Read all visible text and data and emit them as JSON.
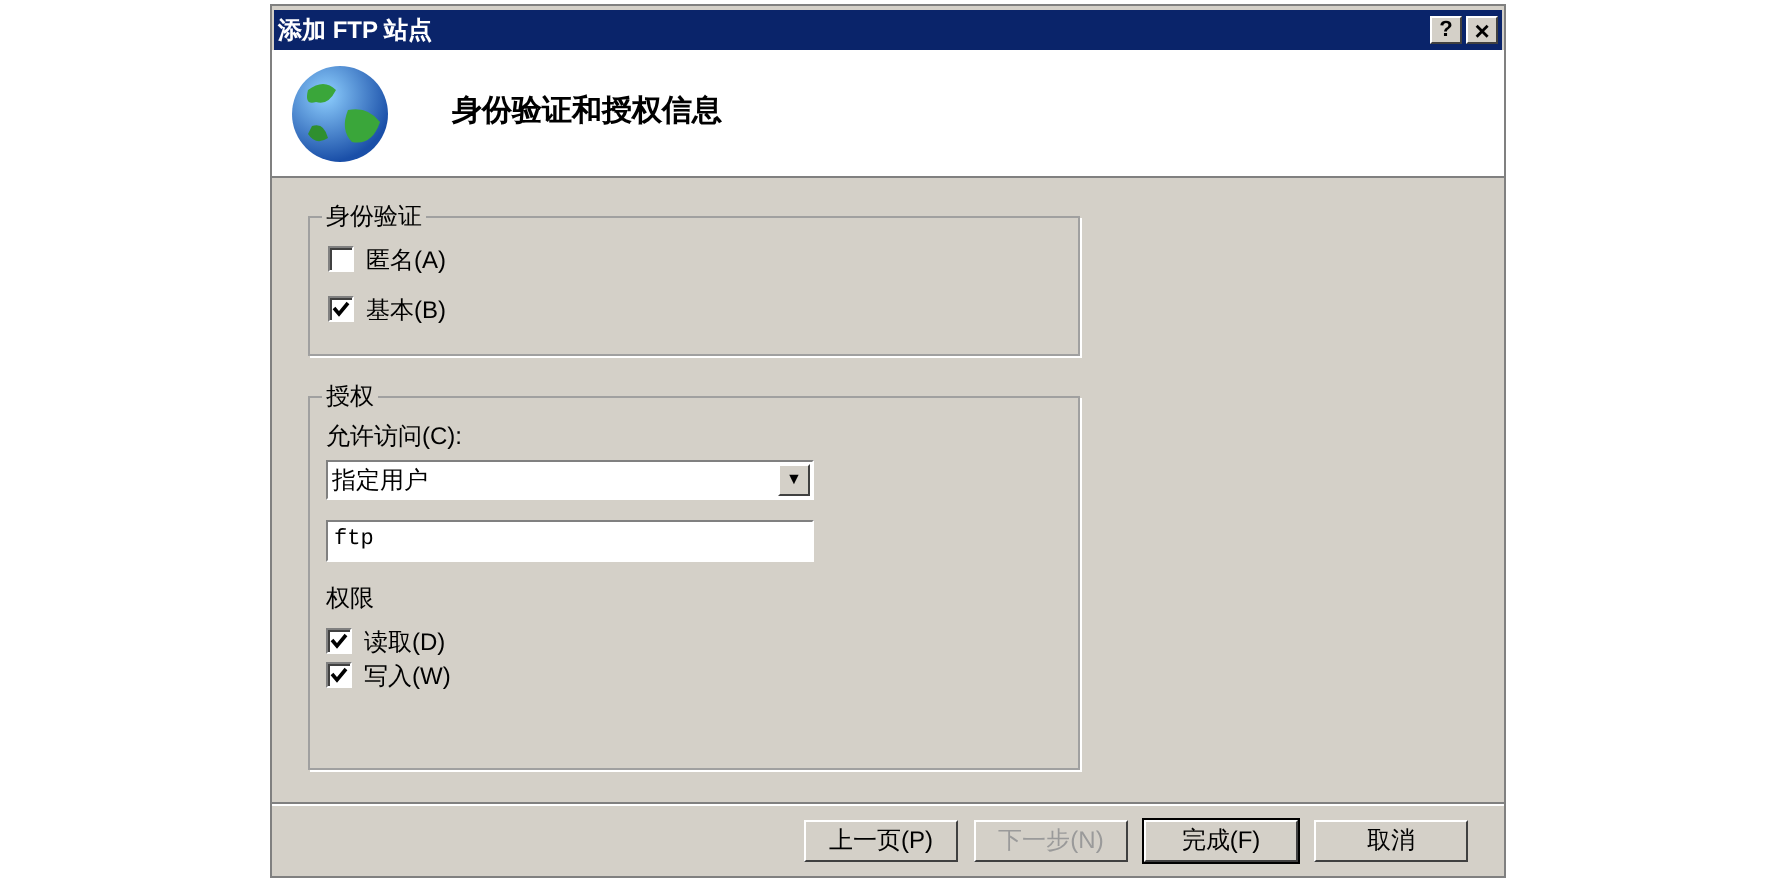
{
  "window": {
    "title": "添加 FTP 站点",
    "help": "?",
    "close": "×"
  },
  "header": {
    "title": "身份验证和授权信息"
  },
  "authentication": {
    "legend": "身份验证",
    "options": [
      {
        "label": "匿名(A)",
        "checked": false
      },
      {
        "label": "基本(B)",
        "checked": true
      }
    ]
  },
  "authorization": {
    "legend": "授权",
    "access_label": "允许访问(C):",
    "access_value": "指定用户",
    "dropdown_arrow": "▼",
    "user_value": "ftp",
    "permissions_label": "权限",
    "permissions": [
      {
        "label": "读取(D)",
        "checked": true
      },
      {
        "label": "写入(W)",
        "checked": true
      }
    ]
  },
  "buttons": [
    {
      "label": "上一页(P)",
      "disabled": false,
      "default": false
    },
    {
      "label": "下一步(N)",
      "disabled": true,
      "default": false
    },
    {
      "label": "完成(F)",
      "disabled": false,
      "default": true
    },
    {
      "label": "取消",
      "disabled": false,
      "default": false
    }
  ]
}
